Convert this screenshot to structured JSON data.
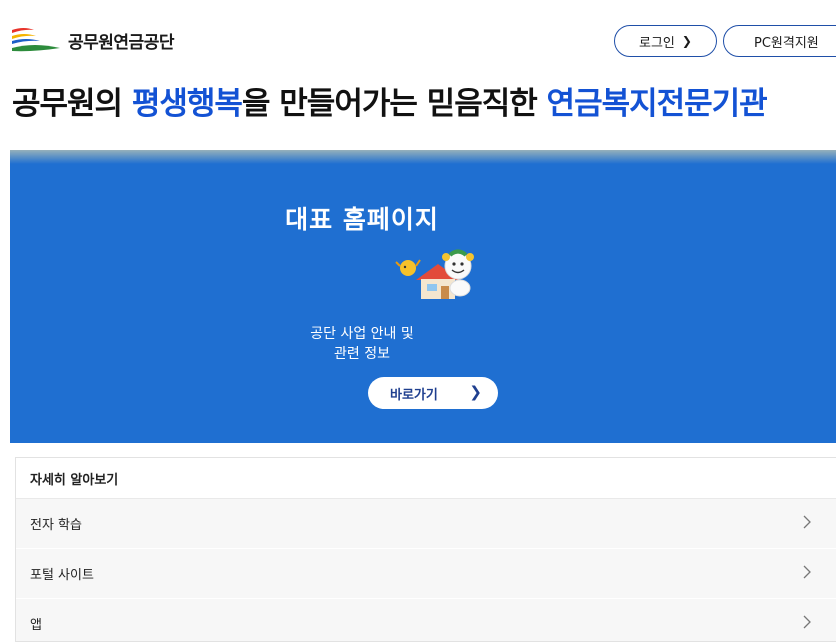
{
  "header": {
    "logo_text": "공무원연금공단",
    "login_label": "로그인",
    "remote_label": "PC원격지원"
  },
  "slogan": {
    "part1": "공무원의 ",
    "highlight1": "평생행복",
    "part2": "을 만들어가는 믿음직한 ",
    "highlight2": "연금복지전문기관"
  },
  "hero": {
    "title": "대표 홈페이지",
    "desc_line1": "공단 사업 안내 및",
    "desc_line2": "관련 정보",
    "go_label": "바로가기"
  },
  "links": {
    "heading": "자세히 알아보기",
    "items": [
      {
        "label": "전자 학습"
      },
      {
        "label": "포털 사이트"
      },
      {
        "label": "앱"
      }
    ]
  },
  "colors": {
    "primary_blue": "#1f6fd1",
    "highlight_blue": "#1352d4",
    "logo_red": "#e8332a",
    "logo_yellow": "#f5b400",
    "logo_blue": "#1d5fc7",
    "logo_green": "#2d8c3c"
  }
}
